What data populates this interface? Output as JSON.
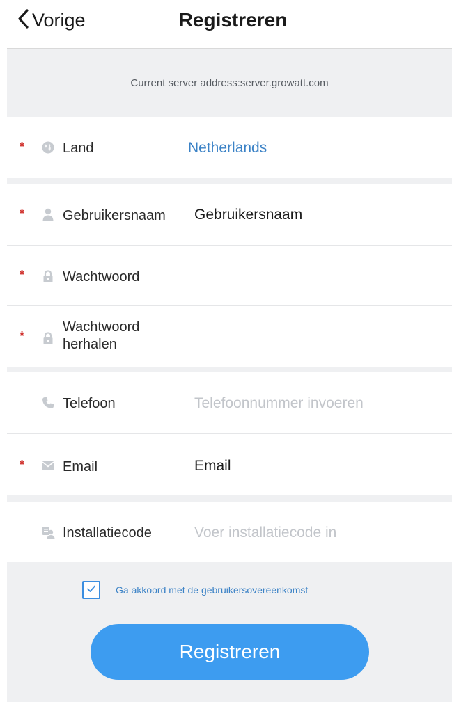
{
  "nav": {
    "back_label": "Vorige",
    "title": "Registreren"
  },
  "server": {
    "text": "Current server address:server.growatt.com"
  },
  "form": {
    "land": {
      "label": "Land",
      "value": "Netherlands",
      "required": true,
      "icon": "globe-icon"
    },
    "username": {
      "label": "Gebruikersnaam",
      "value": "Gebruikersnaam",
      "required": true,
      "icon": "user-icon"
    },
    "password": {
      "label": "Wachtwoord",
      "value": "",
      "required": true,
      "icon": "lock-icon"
    },
    "password_repeat": {
      "label_line1": "Wachtwoord",
      "label_line2": "herhalen",
      "value": "",
      "required": true,
      "icon": "lock-icon"
    },
    "phone": {
      "label": "Telefoon",
      "placeholder": "Telefoonnummer invoeren",
      "required": false,
      "icon": "phone-icon"
    },
    "email": {
      "label": "Email",
      "value": "Email",
      "required": true,
      "icon": "mail-icon"
    },
    "install_code": {
      "label": "Installatiecode",
      "placeholder": "Voer installatiecode in",
      "required": false,
      "icon": "installation-code-icon"
    }
  },
  "required_marker": "*",
  "agreement": {
    "checked": true,
    "text": "Ga akkoord met de gebruikersovereenkomst"
  },
  "register_button": {
    "label": "Registreren"
  },
  "colors": {
    "accent": "#3d9cf0",
    "link": "#3b82c6",
    "required": "#d0312d",
    "section_bg": "#eff0f2",
    "placeholder": "#c2c5ca"
  }
}
